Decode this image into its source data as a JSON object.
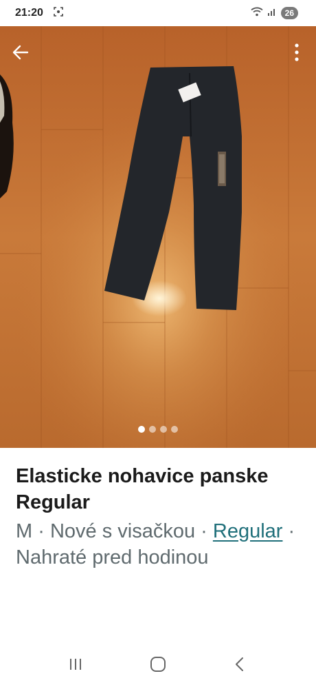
{
  "status_bar": {
    "time": "21:20",
    "battery": "26",
    "icons": [
      "screenshot-icon",
      "wifi-icon",
      "signal-icon"
    ]
  },
  "photo": {
    "description_icons": [
      "back-arrow-icon",
      "more-vert-icon"
    ],
    "page_count": 4,
    "active_page": 1
  },
  "listing": {
    "title": "Elasticke nohavice panske Regular",
    "size": "M",
    "separator": " · ",
    "condition": "Nové s visačkou",
    "brand": "Regular",
    "uploaded": "Nahraté pred hodinou"
  },
  "nav": {
    "icons": [
      "recent-apps-icon",
      "home-icon",
      "back-icon"
    ]
  }
}
